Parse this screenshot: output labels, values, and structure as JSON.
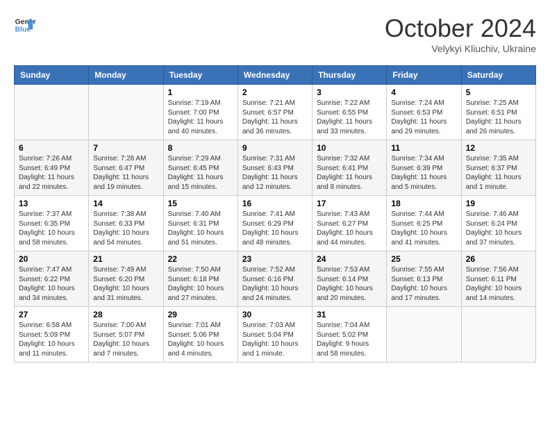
{
  "header": {
    "logo_line1": "General",
    "logo_line2": "Blue",
    "month": "October 2024",
    "location": "Velykyi Kliuchiv, Ukraine"
  },
  "weekdays": [
    "Sunday",
    "Monday",
    "Tuesday",
    "Wednesday",
    "Thursday",
    "Friday",
    "Saturday"
  ],
  "weeks": [
    [
      {
        "day": "",
        "info": ""
      },
      {
        "day": "",
        "info": ""
      },
      {
        "day": "1",
        "info": "Sunrise: 7:19 AM\nSunset: 7:00 PM\nDaylight: 11 hours and 40 minutes."
      },
      {
        "day": "2",
        "info": "Sunrise: 7:21 AM\nSunset: 6:57 PM\nDaylight: 11 hours and 36 minutes."
      },
      {
        "day": "3",
        "info": "Sunrise: 7:22 AM\nSunset: 6:55 PM\nDaylight: 11 hours and 33 minutes."
      },
      {
        "day": "4",
        "info": "Sunrise: 7:24 AM\nSunset: 6:53 PM\nDaylight: 11 hours and 29 minutes."
      },
      {
        "day": "5",
        "info": "Sunrise: 7:25 AM\nSunset: 6:51 PM\nDaylight: 11 hours and 26 minutes."
      }
    ],
    [
      {
        "day": "6",
        "info": "Sunrise: 7:26 AM\nSunset: 6:49 PM\nDaylight: 11 hours and 22 minutes."
      },
      {
        "day": "7",
        "info": "Sunrise: 7:28 AM\nSunset: 6:47 PM\nDaylight: 11 hours and 19 minutes."
      },
      {
        "day": "8",
        "info": "Sunrise: 7:29 AM\nSunset: 6:45 PM\nDaylight: 11 hours and 15 minutes."
      },
      {
        "day": "9",
        "info": "Sunrise: 7:31 AM\nSunset: 6:43 PM\nDaylight: 11 hours and 12 minutes."
      },
      {
        "day": "10",
        "info": "Sunrise: 7:32 AM\nSunset: 6:41 PM\nDaylight: 11 hours and 8 minutes."
      },
      {
        "day": "11",
        "info": "Sunrise: 7:34 AM\nSunset: 6:39 PM\nDaylight: 11 hours and 5 minutes."
      },
      {
        "day": "12",
        "info": "Sunrise: 7:35 AM\nSunset: 6:37 PM\nDaylight: 11 hours and 1 minute."
      }
    ],
    [
      {
        "day": "13",
        "info": "Sunrise: 7:37 AM\nSunset: 6:35 PM\nDaylight: 10 hours and 58 minutes."
      },
      {
        "day": "14",
        "info": "Sunrise: 7:38 AM\nSunset: 6:33 PM\nDaylight: 10 hours and 54 minutes."
      },
      {
        "day": "15",
        "info": "Sunrise: 7:40 AM\nSunset: 6:31 PM\nDaylight: 10 hours and 51 minutes."
      },
      {
        "day": "16",
        "info": "Sunrise: 7:41 AM\nSunset: 6:29 PM\nDaylight: 10 hours and 48 minutes."
      },
      {
        "day": "17",
        "info": "Sunrise: 7:43 AM\nSunset: 6:27 PM\nDaylight: 10 hours and 44 minutes."
      },
      {
        "day": "18",
        "info": "Sunrise: 7:44 AM\nSunset: 6:25 PM\nDaylight: 10 hours and 41 minutes."
      },
      {
        "day": "19",
        "info": "Sunrise: 7:46 AM\nSunset: 6:24 PM\nDaylight: 10 hours and 37 minutes."
      }
    ],
    [
      {
        "day": "20",
        "info": "Sunrise: 7:47 AM\nSunset: 6:22 PM\nDaylight: 10 hours and 34 minutes."
      },
      {
        "day": "21",
        "info": "Sunrise: 7:49 AM\nSunset: 6:20 PM\nDaylight: 10 hours and 31 minutes."
      },
      {
        "day": "22",
        "info": "Sunrise: 7:50 AM\nSunset: 6:18 PM\nDaylight: 10 hours and 27 minutes."
      },
      {
        "day": "23",
        "info": "Sunrise: 7:52 AM\nSunset: 6:16 PM\nDaylight: 10 hours and 24 minutes."
      },
      {
        "day": "24",
        "info": "Sunrise: 7:53 AM\nSunset: 6:14 PM\nDaylight: 10 hours and 20 minutes."
      },
      {
        "day": "25",
        "info": "Sunrise: 7:55 AM\nSunset: 6:13 PM\nDaylight: 10 hours and 17 minutes."
      },
      {
        "day": "26",
        "info": "Sunrise: 7:56 AM\nSunset: 6:11 PM\nDaylight: 10 hours and 14 minutes."
      }
    ],
    [
      {
        "day": "27",
        "info": "Sunrise: 6:58 AM\nSunset: 5:09 PM\nDaylight: 10 hours and 11 minutes."
      },
      {
        "day": "28",
        "info": "Sunrise: 7:00 AM\nSunset: 5:07 PM\nDaylight: 10 hours and 7 minutes."
      },
      {
        "day": "29",
        "info": "Sunrise: 7:01 AM\nSunset: 5:06 PM\nDaylight: 10 hours and 4 minutes."
      },
      {
        "day": "30",
        "info": "Sunrise: 7:03 AM\nSunset: 5:04 PM\nDaylight: 10 hours and 1 minute."
      },
      {
        "day": "31",
        "info": "Sunrise: 7:04 AM\nSunset: 5:02 PM\nDaylight: 9 hours and 58 minutes."
      },
      {
        "day": "",
        "info": ""
      },
      {
        "day": "",
        "info": ""
      }
    ]
  ]
}
